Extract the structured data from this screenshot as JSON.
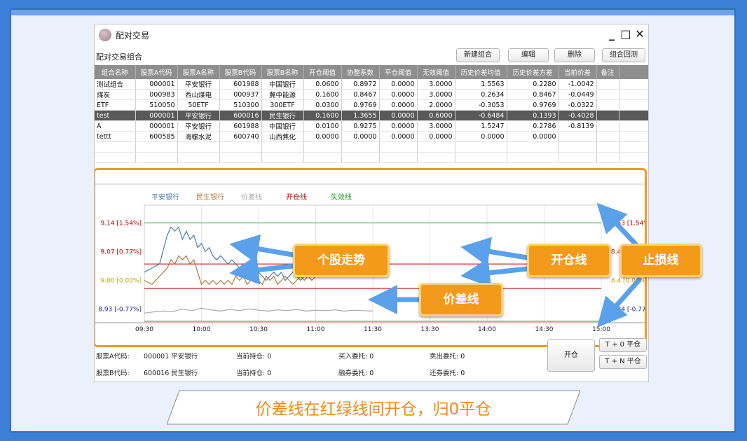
{
  "window": {
    "title": "配对交易",
    "controls": {
      "minimize": "_",
      "maximize": "□",
      "close": "✕"
    }
  },
  "toolbar": {
    "section_label": "配对交易组合",
    "new_label": "新建组合",
    "edit_label": "编辑",
    "delete_label": "删除",
    "backtest_label": "组合回测"
  },
  "table": {
    "columns": [
      "组合名称",
      "股票A代码",
      "股票A名称",
      "股票B代码",
      "股票B名称",
      "开仓阈值",
      "协整系数",
      "平仓阈值",
      "无效阈值",
      "历史价差均值",
      "历史价差方差",
      "当前价差",
      "备注"
    ],
    "rows": [
      [
        "测试组合",
        "000001",
        "平安银行",
        "601988",
        "中国银行",
        "0.0600",
        "0.8972",
        "0.0000",
        "3.0000",
        "1.5563",
        "0.2280",
        "-1.0042",
        ""
      ],
      [
        "煤炭",
        "000983",
        "西山煤电",
        "000937",
        "冀中能源",
        "0.1600",
        "0.8467",
        "0.0000",
        "3.0000",
        "0.2634",
        "0.8467",
        "-0.0449",
        ""
      ],
      [
        "ETF",
        "510050",
        "50ETF",
        "510300",
        "300ETF",
        "0.0300",
        "0.9769",
        "0.0000",
        "2.0000",
        "-0.3053",
        "0.9769",
        "-0.0322",
        ""
      ],
      [
        "test",
        "000001",
        "平安银行",
        "600016",
        "民生银行",
        "0.1600",
        "1.3655",
        "0.0000",
        "0.6000",
        "-0.6484",
        "0.1393",
        "-0.4028",
        ""
      ],
      [
        "A",
        "000001",
        "平安银行",
        "601988",
        "中国银行",
        "0.0100",
        "0.9275",
        "0.0000",
        "3.0000",
        "1.5247",
        "0.2786",
        "-0.8139",
        ""
      ],
      [
        "tettt",
        "600585",
        "海螺水泥",
        "600740",
        "山西焦化",
        "0.0000",
        "0.0000",
        "0.0000",
        "0.0000",
        "0.0000",
        "0.0000",
        "",
        ""
      ]
    ],
    "selected_row": 3
  },
  "chart_data": {
    "type": "line",
    "legend": [
      {
        "name": "平安银行",
        "color": "#4a7fa8"
      },
      {
        "name": "民生银行",
        "color": "#b07a3a"
      },
      {
        "name": "价差线",
        "color": "#aaaaaa"
      },
      {
        "name": "开仓线",
        "color": "#c00000"
      },
      {
        "name": "失效线",
        "color": "#1a9a1a"
      }
    ],
    "left_ticks": [
      {
        "label": "9.14 [1.54%]",
        "color": "#c00000"
      },
      {
        "label": "9.07 [0.77%]",
        "color": "#c00000"
      },
      {
        "label": "9.00 [0.00%]",
        "color": "#c8a000"
      },
      {
        "label": "8.93 [-0.77%]",
        "color": "#1a1aa0"
      }
    ],
    "right_ticks": [
      {
        "label": "8.53 [1.54%]",
        "color": "#c00000"
      },
      {
        "label": "8.46 [0.77%]",
        "color": "#c00000"
      },
      {
        "label": "8.4 [0.00%]",
        "color": "#c8a000"
      },
      {
        "label": "8.34 [-0.77%]",
        "color": "#1a1aa0"
      }
    ],
    "x_ticks": [
      "09:30",
      "10:00",
      "10:30",
      "11:00",
      "11:30",
      "13:30",
      "14:00",
      "14:30",
      "15:00"
    ],
    "x_range": [
      0,
      240
    ],
    "y_range": [
      8.9,
      9.17
    ],
    "lines": {
      "open_upper": 9.04,
      "open_lower": 8.98,
      "invalid_upper": 9.14,
      "invalid_lower": 8.9
    },
    "series": [
      {
        "name": "平安银行",
        "x": [
          0,
          4,
          8,
          12,
          14,
          16,
          18,
          20,
          22,
          24,
          26,
          28,
          30,
          32,
          34,
          36,
          38,
          40,
          42,
          44,
          46,
          48,
          50,
          52,
          54,
          56,
          58,
          60,
          62,
          64,
          66,
          68,
          70,
          72,
          74,
          76,
          78,
          80,
          82,
          84,
          86,
          88,
          90
        ],
        "values": [
          9.02,
          9.03,
          9.04,
          9.11,
          9.13,
          9.12,
          9.13,
          9.1,
          9.12,
          9.1,
          9.11,
          9.08,
          9.09,
          9.07,
          9.08,
          9.06,
          9.05,
          9.06,
          9.05,
          9.04,
          9.05,
          9.04,
          9.03,
          9.04,
          9.02,
          9.03,
          9.01,
          9.02,
          9.01,
          9.0,
          9.01,
          9.02,
          9.01,
          9.02,
          9.0,
          9.01,
          9.02,
          9.01,
          9.0,
          9.01,
          9.02,
          9.01,
          9.02
        ]
      },
      {
        "name": "民生银行",
        "x": [
          0,
          4,
          8,
          12,
          14,
          16,
          18,
          20,
          22,
          24,
          26,
          28,
          30,
          32,
          34,
          36,
          38,
          40,
          42,
          44,
          46,
          48,
          50,
          52,
          54,
          56,
          58,
          60,
          62,
          64,
          66,
          68,
          70,
          72,
          74,
          76,
          78,
          80,
          82,
          84,
          86,
          88,
          90
        ],
        "values": [
          9.0,
          8.99,
          9.01,
          9.03,
          9.05,
          9.04,
          9.06,
          9.05,
          9.06,
          9.04,
          9.05,
          9.02,
          8.99,
          9.0,
          8.99,
          9.0,
          8.99,
          9.0,
          8.99,
          9.0,
          8.99,
          9.01,
          9.0,
          9.01,
          8.99,
          9.0,
          9.01,
          9.0,
          8.99,
          9.01,
          9.0,
          9.01,
          8.99,
          9.0,
          9.01,
          9.0,
          8.99,
          9.0,
          9.01,
          9.0,
          9.01,
          9.0,
          9.01
        ]
      },
      {
        "name": "价差线",
        "x": [
          0,
          5,
          10,
          15,
          20,
          25,
          30,
          35,
          40,
          45,
          50,
          55,
          60,
          65,
          70,
          75,
          80,
          85,
          90,
          95,
          100,
          105,
          110,
          115,
          120
        ],
        "values": [
          8.92,
          8.923,
          8.925,
          8.924,
          8.93,
          8.926,
          8.932,
          8.928,
          8.925,
          8.929,
          8.926,
          8.93,
          8.927,
          8.925,
          8.928,
          8.926,
          8.929,
          8.925,
          8.927,
          8.926,
          8.928,
          8.925,
          8.927,
          8.926,
          8.925
        ]
      }
    ]
  },
  "status": {
    "stockA_label": "股票A代码:",
    "stockA_value": "000001 平安银行",
    "stockB_label": "股票B代码:",
    "stockB_value": "600016 民生银行",
    "holdA": "当前持仓: 0",
    "holdB": "当前持仓: 0",
    "buy_order": "买入委托: 0",
    "margin_order": "融券委托: 0",
    "sell_order": "卖出委托: 0",
    "repay_order": "还券委托: 0",
    "open_button": "开仓",
    "t0_button": "T + 0 平仓",
    "tn_button": "T + N 平仓"
  },
  "annotations": {
    "stock_trend": "个股走势",
    "open_line": "开仓线",
    "stop_loss": "止损线",
    "spread_line": "价差线",
    "caption": "价差线在红绿线间开仓，归0平仓",
    "accent_color": "#f39a1b"
  }
}
